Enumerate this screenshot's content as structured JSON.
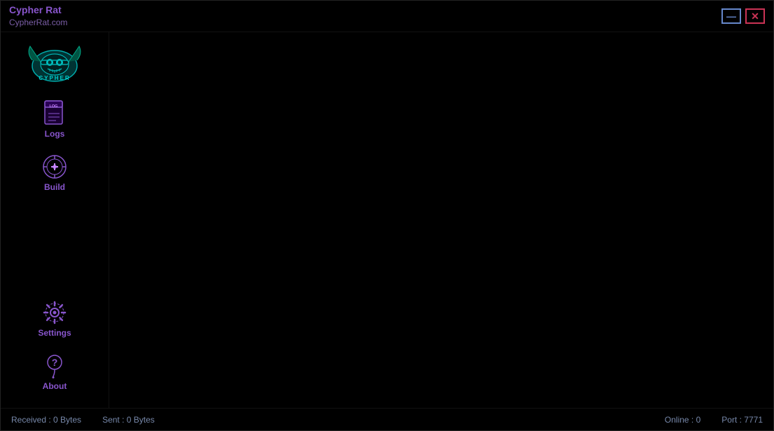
{
  "titlebar": {
    "main_title": "Cypher Rat",
    "sub_title": "CypherRat.com"
  },
  "window_controls": {
    "minimize_label": "—",
    "close_label": "✕"
  },
  "sidebar": {
    "items": [
      {
        "id": "logs",
        "label": "Logs"
      },
      {
        "id": "build",
        "label": "Build"
      },
      {
        "id": "settings",
        "label": "Settings"
      },
      {
        "id": "about",
        "label": "About"
      }
    ]
  },
  "statusbar": {
    "received": "Received : 0 Bytes",
    "sent": "Sent : 0 Bytes",
    "online": "Online : 0",
    "port": "Port : 7771"
  }
}
